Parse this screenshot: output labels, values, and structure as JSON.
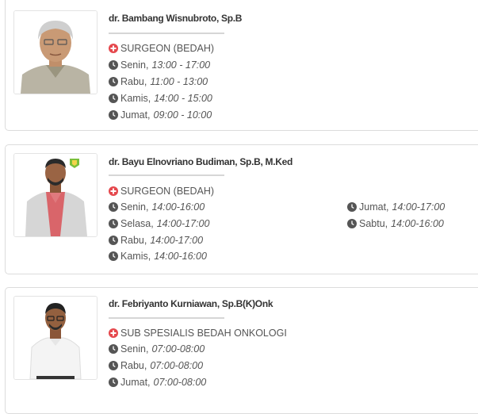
{
  "colors": {
    "spec_icon": "#e5484d",
    "clock_icon": "#555555",
    "border": "#dcdcdc"
  },
  "doctors": [
    {
      "name": "dr. Bambang Wisnubroto, Sp.B",
      "specialty": "SURGEON (BEDAH)",
      "schedule": [
        {
          "day": "Senin,",
          "time": "13:00 - 17:00"
        },
        {
          "day": "Rabu,",
          "time": "11:00 - 13:00"
        },
        {
          "day": "Kamis,",
          "time": "14:00 - 15:00"
        },
        {
          "day": "Jumat,",
          "time": "09:00 - 10:00"
        }
      ]
    },
    {
      "name": "dr. Bayu Elnovriano Budiman, Sp.B, M.Ked",
      "specialty": "SURGEON (BEDAH)",
      "schedule": [
        {
          "day": "Senin,",
          "time": "14:00-16:00"
        },
        {
          "day": "Selasa,",
          "time": "14:00-17:00"
        },
        {
          "day": "Rabu,",
          "time": "14:00-17:00"
        },
        {
          "day": "Kamis,",
          "time": "14:00-16:00"
        },
        {
          "day": "Jumat,",
          "time": "14:00-17:00"
        },
        {
          "day": "Sabtu,",
          "time": "14:00-16:00"
        }
      ]
    },
    {
      "name": "dr. Febriyanto Kurniawan, Sp.B(K)Onk",
      "specialty": "SUB SPESIALIS BEDAH ONKOLOGI",
      "schedule": [
        {
          "day": "Senin,",
          "time": "07:00-08:00"
        },
        {
          "day": "Rabu,",
          "time": "07:00-08:00"
        },
        {
          "day": "Jumat,",
          "time": "07:00-08:00"
        }
      ]
    }
  ]
}
